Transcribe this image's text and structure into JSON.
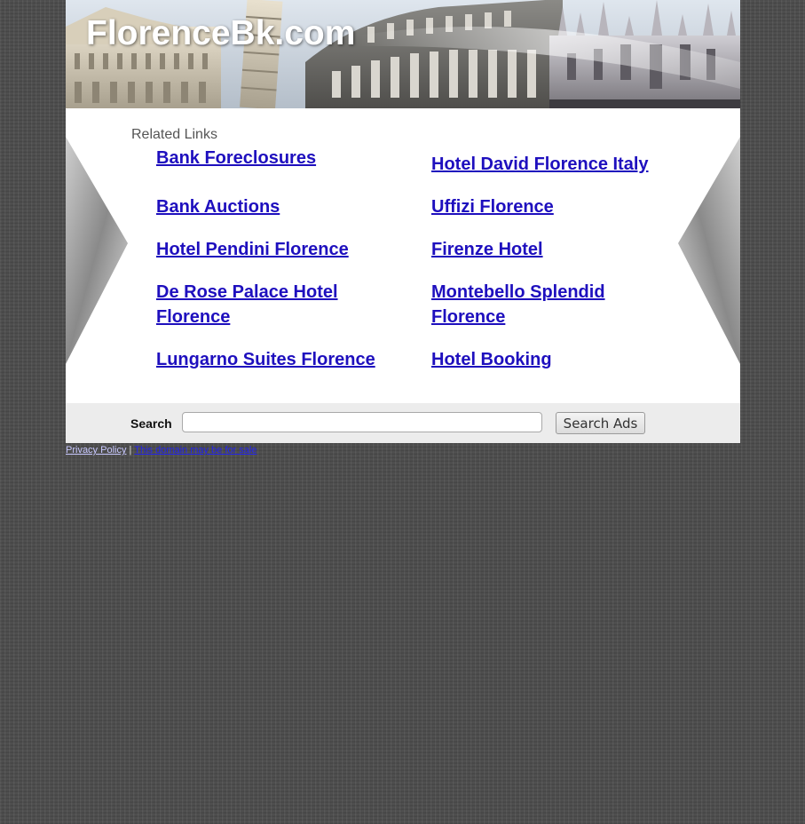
{
  "site": {
    "title": "FlorenceBk.com"
  },
  "related": {
    "heading": "Related Links",
    "links": [
      "Bank Foreclosures",
      "Hotel David Florence Italy",
      "Bank Auctions",
      "Uffizi Florence",
      "Hotel Pendini Florence",
      "Firenze Hotel",
      "De Rose Palace Hotel Florence",
      "Montebello Splendid Florence",
      "Lungarno Suites Florence",
      "Hotel Booking"
    ]
  },
  "search": {
    "label": "Search",
    "value": "",
    "button_label": "Search Ads"
  },
  "footer": {
    "privacy_label": "Privacy Policy",
    "separator": "|",
    "sale_label": "This domain may be for sale"
  },
  "colors": {
    "link": "#1e0fbe",
    "page_background": "#4d4d4d",
    "search_bar": "#ececec"
  },
  "icons": {
    "left_decoration": "chevron-right-shape",
    "right_decoration": "chevron-left-shape"
  }
}
